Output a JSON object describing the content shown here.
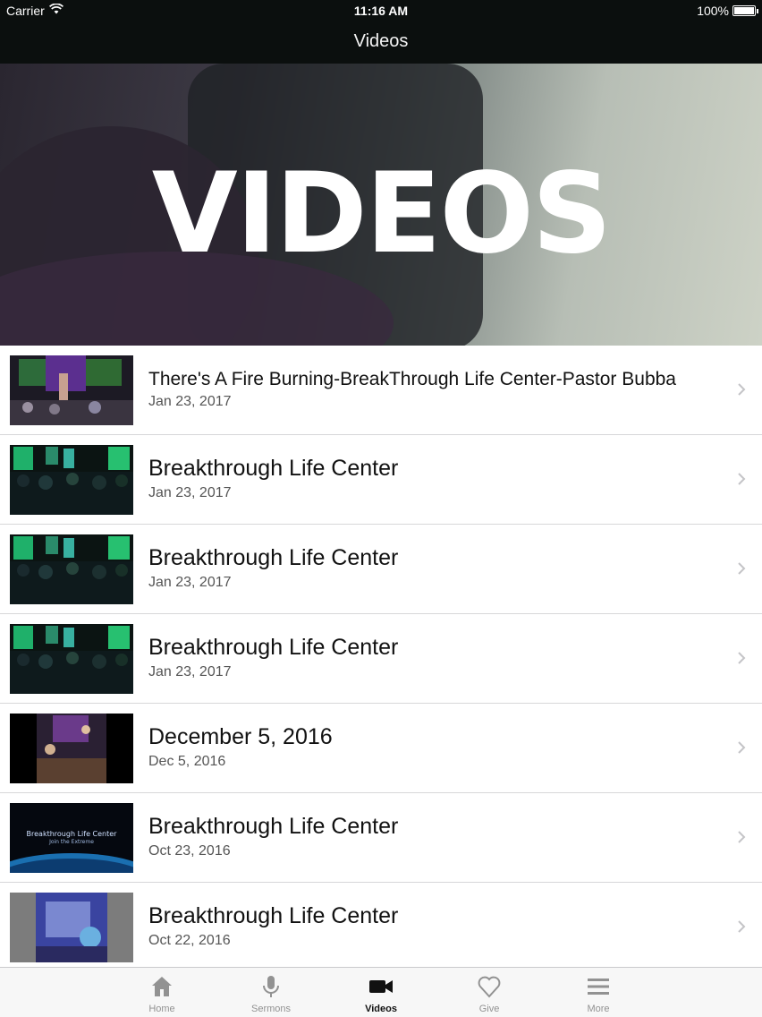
{
  "status_bar": {
    "carrier": "Carrier",
    "time": "11:16 AM",
    "battery": "100%"
  },
  "nav": {
    "title": "Videos"
  },
  "hero": {
    "text": "VIDEOS"
  },
  "videos": [
    {
      "title": "There's A Fire Burning-BreakThrough Life Center-Pastor Bubba",
      "date": "Jan 23, 2017",
      "thumb": "stage-purple"
    },
    {
      "title": "Breakthrough Life Center",
      "date": "Jan 23, 2017",
      "thumb": "stage-green"
    },
    {
      "title": "Breakthrough Life Center",
      "date": "Jan 23, 2017",
      "thumb": "stage-green"
    },
    {
      "title": "Breakthrough Life Center",
      "date": "Jan 23, 2017",
      "thumb": "stage-green"
    },
    {
      "title": "December 5, 2016",
      "date": "Dec 5, 2016",
      "thumb": "stage-dark"
    },
    {
      "title": "Breakthrough Life Center",
      "date": "Oct 23, 2016",
      "thumb": "title-card",
      "thumb_text": [
        "Breakthrough Life Center",
        "Join the Extreme"
      ]
    },
    {
      "title": "Breakthrough Life Center",
      "date": "Oct 22, 2016",
      "thumb": "stage-blue"
    }
  ],
  "tabs": [
    {
      "label": "Home",
      "icon": "home-icon"
    },
    {
      "label": "Sermons",
      "icon": "microphone-icon"
    },
    {
      "label": "Videos",
      "icon": "video-camera-icon",
      "active": true
    },
    {
      "label": "Give",
      "icon": "heart-icon"
    },
    {
      "label": "More",
      "icon": "menu-icon"
    }
  ],
  "colors": {
    "nav_bg": "#0b0f0e",
    "tab_active": "#111111",
    "tab_inactive": "#929292",
    "separator": "#d7d7d9"
  }
}
